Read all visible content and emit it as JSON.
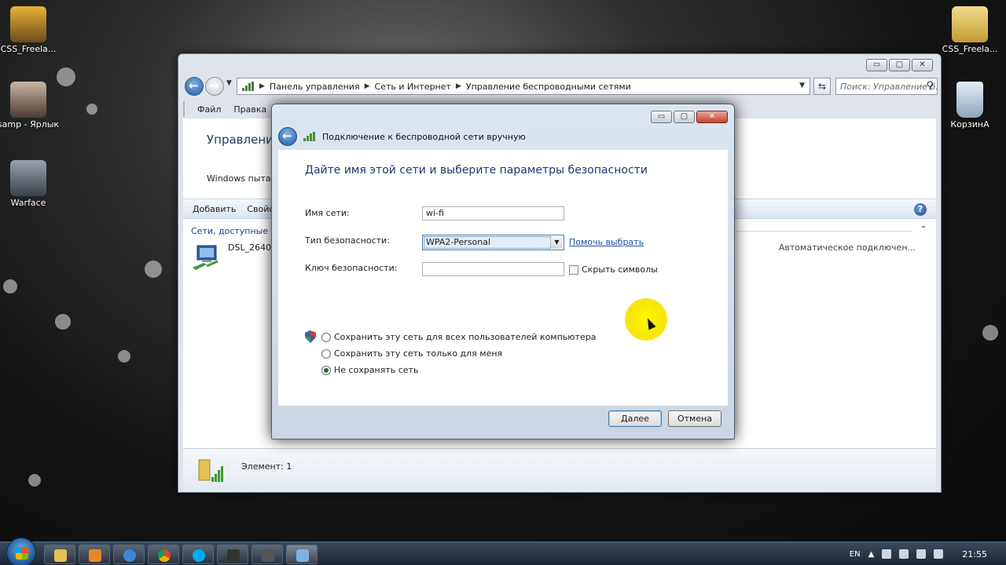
{
  "desktop": {
    "icons": [
      {
        "label": "CSS_Freela..."
      },
      {
        "label": "samp - Ярлык"
      },
      {
        "label": "Warface"
      },
      {
        "label": "CSS_Freela..."
      },
      {
        "label": "КорзинА"
      }
    ]
  },
  "explorer": {
    "caption": {
      "minimize": "▭",
      "maximize": "▢",
      "close": "✕"
    },
    "breadcrumb": [
      "Панель управления",
      "Сеть и Интернет",
      "Управление беспроводными сетями"
    ],
    "search_placeholder": "Поиск: Управление б...",
    "menu": [
      "Файл",
      "Правка"
    ],
    "title": "Управление",
    "subtitle": "Windows пытает",
    "toolbar": [
      "Добавить",
      "Свойс"
    ],
    "help": "?",
    "group_header": "Сети, доступные дл",
    "network": {
      "name": "DSL_2640N",
      "status": "Автоматическое подключен..."
    },
    "status_bar": {
      "text": "Элемент: 1"
    }
  },
  "dialog": {
    "title": "Подключение к беспроводной сети вручную",
    "heading": "Дайте имя этой сети и выберите параметры безопасности",
    "network_name_label": "Имя сети:",
    "network_name_value": "wi-fi",
    "security_type_label": "Тип безопасности:",
    "security_type_value": "WPA2-Personal",
    "help_link": "Помочь выбрать",
    "security_key_label": "Ключ безопасности:",
    "security_key_value": "",
    "hide_chars_label": "Скрыть символы",
    "radios": [
      {
        "label": "Сохранить эту сеть для всех пользователей компьютера",
        "checked": false
      },
      {
        "label": "Сохранить эту сеть только для меня",
        "checked": false
      },
      {
        "label": "Не сохранять сеть",
        "checked": true
      }
    ],
    "next_button": "Далее",
    "cancel_button": "Отмена"
  },
  "taskbar": {
    "language": "EN",
    "time": "21:55"
  },
  "colors": {
    "accent": "#1f5ea3",
    "link": "#1b4fa8",
    "cursor_highlight": "#fff600"
  }
}
